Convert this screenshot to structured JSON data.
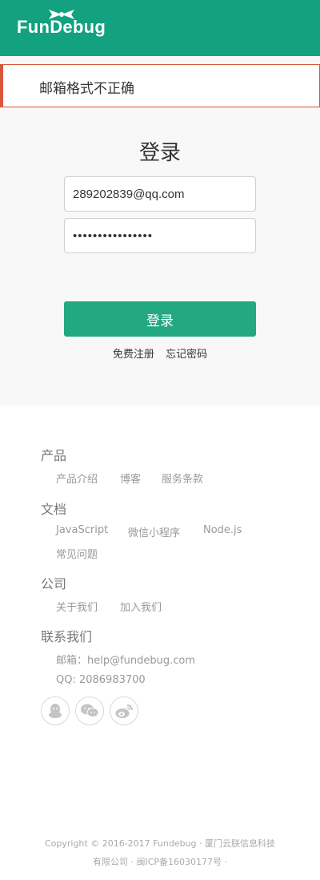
{
  "header": {
    "logo_text": "FunDebug"
  },
  "alert": {
    "message": "邮箱格式不正确"
  },
  "login": {
    "title": "登录",
    "email_value": "289202839@qq.com",
    "password_mask": "••••••••••••••••",
    "button_label": "登录",
    "signup_link": "免费注册",
    "forgot_link": "忘记密码"
  },
  "footer": {
    "sections": [
      {
        "heading": "产品",
        "links": [
          "产品介绍",
          "博客",
          "服务条款"
        ]
      },
      {
        "heading": "文档",
        "links": [
          "JavaScript",
          "微信小程序",
          "Node.js",
          "常见问题"
        ]
      },
      {
        "heading": "公司",
        "links": [
          "关于我们",
          "加入我们"
        ]
      },
      {
        "heading": "联系我们",
        "links": [
          "邮箱：help@fundebug.com",
          "QQ: 2086983700"
        ]
      }
    ],
    "social_icons": [
      "qq-icon",
      "wechat-icon",
      "weibo-icon"
    ],
    "copyright_line1": "Copyright © 2016-2017 Fundebug · 厦门云朕信息科技",
    "copyright_line2": "有限公司 · 闽ICP备16030177号 ·"
  },
  "colors": {
    "brand": "#13a27f",
    "button": "#22a882",
    "alert_border": "#d9573c"
  }
}
